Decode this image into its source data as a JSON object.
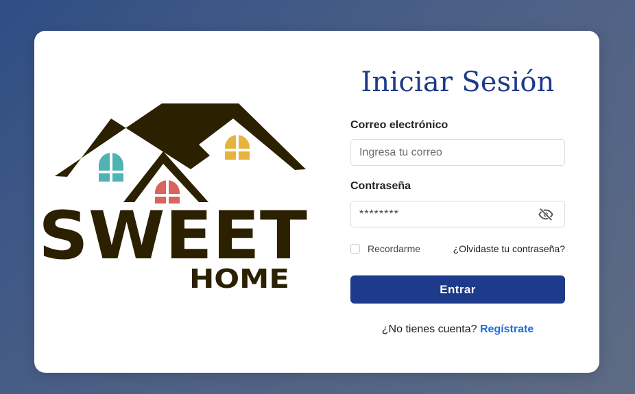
{
  "login": {
    "title": "Iniciar Sesión",
    "email_label": "Correo electrónico",
    "email_placeholder": "Ingresa tu correo",
    "email_value": "",
    "password_label": "Contraseña",
    "password_value": "********",
    "password_icon": "eye-off-icon",
    "remember_label": "Recordarme",
    "remember_checked": false,
    "forgot_link": "¿Olvidaste tu contraseña?",
    "submit_label": "Entrar",
    "signup_prompt": "¿No tienes cuenta?",
    "signup_link": "Regístrate"
  },
  "logo": {
    "main_text": "SWEET",
    "sub_text": "HOME",
    "colors": {
      "roof": "#2b2000",
      "window_left": "#4fb3b3",
      "window_center": "#d9635f",
      "window_right": "#e6b43c"
    }
  },
  "colors": {
    "primary": "#1e3a8a",
    "link": "#1e6fd9",
    "background_start": "#2f4e85",
    "background_end": "#5e6b84"
  }
}
